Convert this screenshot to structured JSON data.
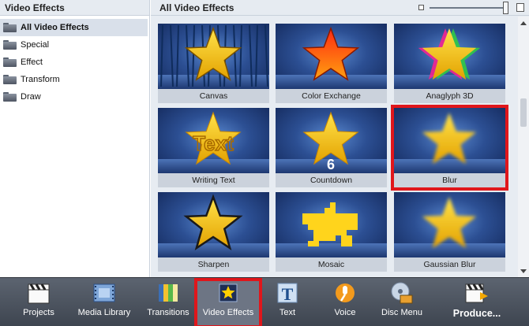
{
  "left_panel": {
    "title": "Video Effects",
    "items": [
      {
        "label": "All Video Effects",
        "selected": true
      },
      {
        "label": "Special"
      },
      {
        "label": "Effect"
      },
      {
        "label": "Transform"
      },
      {
        "label": "Draw"
      }
    ]
  },
  "right_panel": {
    "title": "All Video Effects",
    "tiles": [
      {
        "label": "Canvas",
        "style": "canvas"
      },
      {
        "label": "Color Exchange",
        "style": "color-exchange"
      },
      {
        "label": "Anaglyph 3D",
        "style": "anaglyph"
      },
      {
        "label": "Writing Text",
        "style": "writing-text",
        "overlay": "Text"
      },
      {
        "label": "Countdown",
        "style": "countdown",
        "overlay": "6"
      },
      {
        "label": "Blur",
        "style": "blur",
        "highlighted": true
      },
      {
        "label": "Sharpen",
        "style": "sharpen"
      },
      {
        "label": "Mosaic",
        "style": "mosaic"
      },
      {
        "label": "Gaussian Blur",
        "style": "gaussian"
      }
    ]
  },
  "toolbar": {
    "buttons": [
      {
        "label": "Projects",
        "icon": "clapperboard-icon"
      },
      {
        "label": "Media Library",
        "icon": "film-strip-icon"
      },
      {
        "label": "Transitions",
        "icon": "transitions-icon"
      },
      {
        "label": "Video Effects",
        "icon": "star-frame-icon",
        "active": true
      },
      {
        "label": "Text",
        "icon": "text-t-icon"
      },
      {
        "label": "Voice",
        "icon": "microphone-icon"
      },
      {
        "label": "Disc Menu",
        "icon": "disc-menu-icon"
      },
      {
        "label": "Produce...",
        "icon": "produce-clapper-icon"
      }
    ]
  },
  "colors": {
    "highlight": "#e0161b",
    "star_fill": "#f5c400",
    "star_edge": "#c97f00",
    "toolbar_bg": "#4b525d"
  }
}
